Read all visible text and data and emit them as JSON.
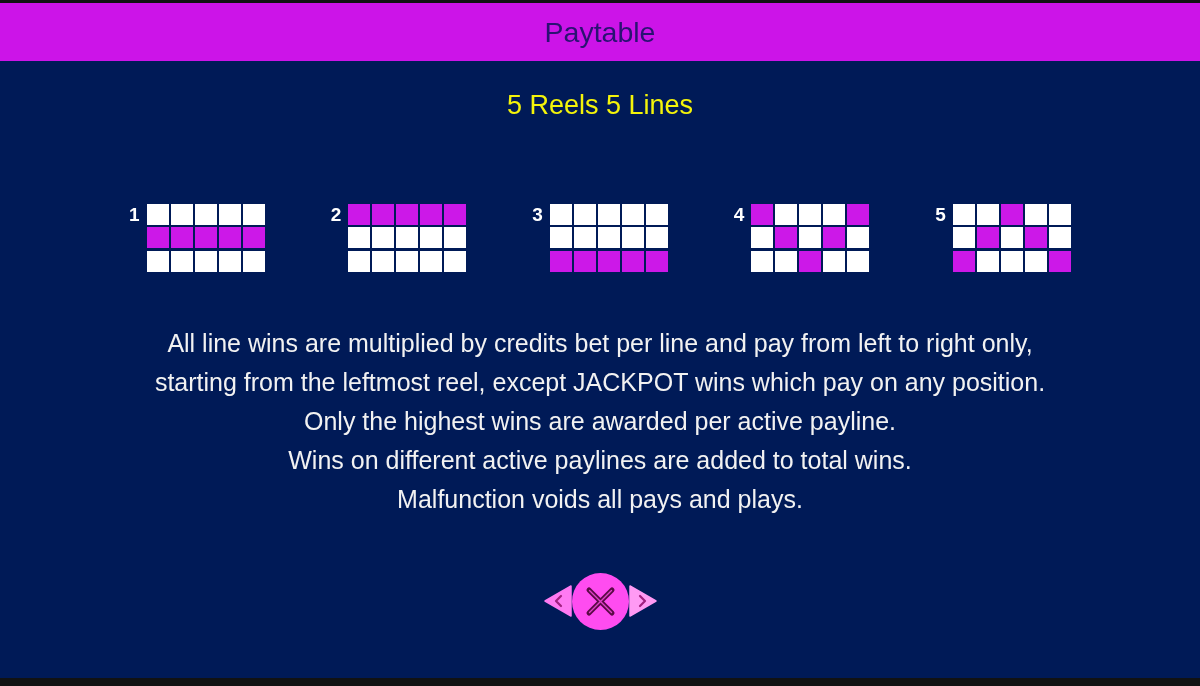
{
  "header": {
    "title": "Paytable"
  },
  "subtitle": "5 Reels 5 Lines",
  "paylines": [
    {
      "number": "1",
      "rows": [
        [
          false,
          false,
          false,
          false,
          false
        ],
        [
          true,
          true,
          true,
          true,
          true
        ],
        [
          false,
          false,
          false,
          false,
          false
        ]
      ]
    },
    {
      "number": "2",
      "rows": [
        [
          true,
          true,
          true,
          true,
          true
        ],
        [
          false,
          false,
          false,
          false,
          false
        ],
        [
          false,
          false,
          false,
          false,
          false
        ]
      ]
    },
    {
      "number": "3",
      "rows": [
        [
          false,
          false,
          false,
          false,
          false
        ],
        [
          false,
          false,
          false,
          false,
          false
        ],
        [
          true,
          true,
          true,
          true,
          true
        ]
      ]
    },
    {
      "number": "4",
      "rows": [
        [
          true,
          false,
          false,
          false,
          true
        ],
        [
          false,
          true,
          false,
          true,
          false
        ],
        [
          false,
          false,
          true,
          false,
          false
        ]
      ]
    },
    {
      "number": "5",
      "rows": [
        [
          false,
          false,
          true,
          false,
          false
        ],
        [
          false,
          true,
          false,
          true,
          false
        ],
        [
          true,
          false,
          false,
          false,
          true
        ]
      ]
    }
  ],
  "rules": [
    "All line wins are multiplied by credits bet per line and pay from left to right only,",
    "starting from the leftmost reel, except JACKPOT wins which pay on any position.",
    "Only the highest wins are awarded per active payline.",
    "Wins on different active paylines are added to total wins.",
    "Malfunction voids all pays and plays."
  ],
  "controls": [
    {
      "kind": "previous"
    },
    {
      "kind": "close"
    },
    {
      "kind": "next"
    }
  ]
}
